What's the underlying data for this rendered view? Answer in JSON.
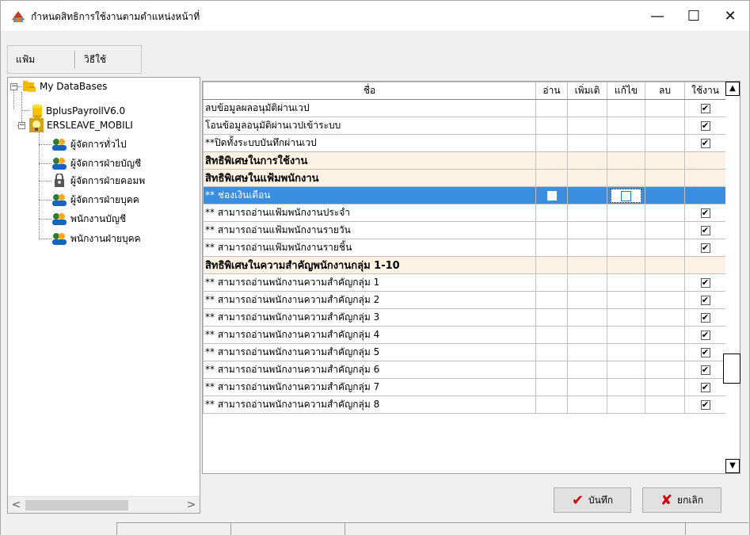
{
  "window": {
    "title": "กำหนดสิทธิการใช้งานตามตำแหน่งหน้าที่",
    "minimize_symbol": "—",
    "maximize_symbol": "☐",
    "close_symbol": "✕"
  },
  "menu": {
    "file": "แฟ้ม",
    "help": "วิธีใช้"
  },
  "tree": {
    "root": {
      "label": "My DataBases",
      "expander": "−",
      "icon": "database-folder-icon"
    },
    "db1": {
      "label": "BplusPayrollV6.0",
      "icon": "database-icon"
    },
    "db2": {
      "label": "ERSLEAVE_MOBILI",
      "expander": "−",
      "icon": "bulb-icon"
    },
    "roles": [
      {
        "label": "ผู้จัดการทั่วไป",
        "icon": "user-group-icon"
      },
      {
        "label": "ผู้จัดการฝ่ายบัญชี",
        "icon": "user-group-icon"
      },
      {
        "label": "ผู้จัดการฝ่ายคอมพ",
        "icon": "user-lock-icon"
      },
      {
        "label": "ผู้จัดการฝ่ายบุคค",
        "icon": "user-group-icon"
      },
      {
        "label": "พนักงานบัญชี",
        "icon": "user-group-icon"
      },
      {
        "label": "พนักงานฝ่ายบุคค",
        "icon": "user-group-icon"
      }
    ],
    "scroll_left": "<",
    "scroll_right": ">"
  },
  "grid": {
    "columns": [
      "ชื่อ",
      "อ่าน",
      "เพิ่มเติ",
      "แก้ไข",
      "ลบ",
      "ใช้งาน"
    ],
    "check_mark": "✔",
    "rows": [
      {
        "name": "ลบข้อมูลผลอนุมัติผ่านเวป",
        "type": "normal",
        "use": true
      },
      {
        "name": "โอนข้อมูลอนุมัติผ่านเวปเข้าระบบ",
        "type": "normal",
        "use": true
      },
      {
        "name": "**ปิดทั้งระบบบันทึกผ่านเวป",
        "type": "normal",
        "use": true
      },
      {
        "name": "สิทธิพิเศษในการใช้งาน",
        "type": "section"
      },
      {
        "name": "สิทธิพิเศษในแฟ้มพนักงาน",
        "type": "section"
      },
      {
        "name": "** ช่องเงินเดือน",
        "type": "selected"
      },
      {
        "name": "** สามารถอ่านแฟ้มพนักงานประจำ",
        "type": "normal",
        "use": true
      },
      {
        "name": "** สามารถอ่านแฟ้มพนักงานรายวัน",
        "type": "normal",
        "use": true
      },
      {
        "name": "** สามารถอ่านแฟ้มพนักงานรายชิ้น",
        "type": "normal",
        "use": true
      },
      {
        "name": "สิทธิพิเศษในความสำคัญพนักงานกลุ่ม 1-10",
        "type": "section"
      },
      {
        "name": "** สามารถอ่านพนักงานความสำคัญกลุ่ม 1",
        "type": "normal",
        "use": true
      },
      {
        "name": "** สามารถอ่านพนักงานความสำคัญกลุ่ม 2",
        "type": "normal",
        "use": true
      },
      {
        "name": "** สามารถอ่านพนักงานความสำคัญกลุ่ม 3",
        "type": "normal",
        "use": true
      },
      {
        "name": "** สามารถอ่านพนักงานความสำคัญกลุ่ม 4",
        "type": "normal",
        "use": true
      },
      {
        "name": "** สามารถอ่านพนักงานความสำคัญกลุ่ม 5",
        "type": "normal",
        "use": true
      },
      {
        "name": "** สามารถอ่านพนักงานความสำคัญกลุ่ม 6",
        "type": "normal",
        "use": true
      },
      {
        "name": "** สามารถอ่านพนักงานความสำคัญกลุ่ม 7",
        "type": "normal",
        "use": true
      },
      {
        "name": "** สามารถอ่านพนักงานความสำคัญกลุ่ม 8",
        "type": "normal",
        "use": true
      }
    ],
    "scroll_up": "▲",
    "scroll_down": "▼"
  },
  "buttons": {
    "save": "บันทึก",
    "save_icon": "✔",
    "cancel": "ยกเลิก",
    "cancel_icon": "✘"
  },
  "colors": {
    "selection": "#3a8ddf",
    "section_bg": "#fdf2e3",
    "icon_red": "#d40000"
  }
}
